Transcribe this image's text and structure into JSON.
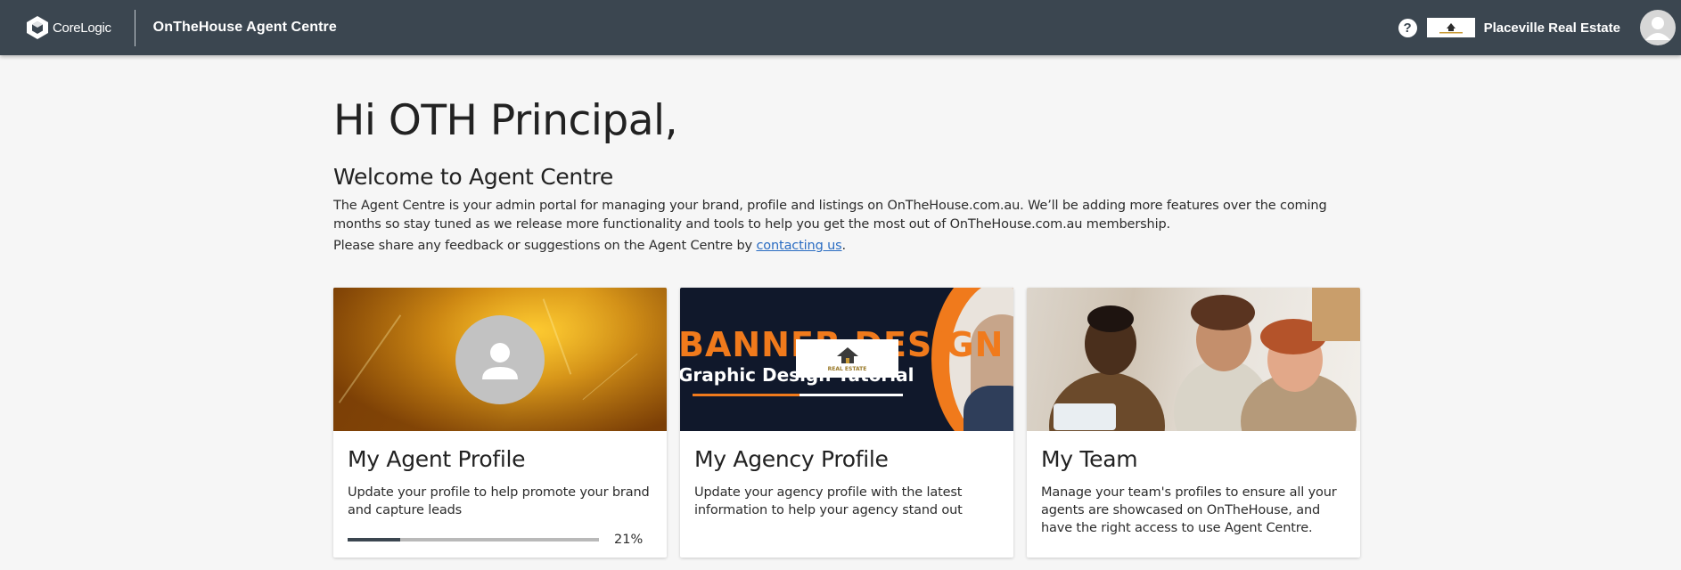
{
  "header": {
    "brand_name": "CoreLogic",
    "app_title": "OnTheHouse Agent Centre",
    "help_symbol": "?",
    "agency_name": "Placeville Real Estate",
    "icons": [
      "corelogic-logo",
      "help-icon",
      "agency-logo",
      "user-avatar-icon"
    ]
  },
  "main": {
    "greeting": "Hi OTH Principal,",
    "welcome_title": "Welcome to Agent Centre",
    "intro": "The Agent Centre is your admin portal for managing your brand, profile and listings on OnTheHouse.com.au. We’ll be adding more features over the coming months so stay tuned as we release more functionality and tools to help you get the most out of OnTheHouse.com.au membership.",
    "feedback_prefix": "Please share any feedback or suggestions on the Agent Centre by ",
    "feedback_link": "contacting us",
    "feedback_suffix": "."
  },
  "cards": [
    {
      "title": "My Agent Profile",
      "description": "Update your profile to help promote your brand and capture leads",
      "progress_percent": 21,
      "progress_label": "21%"
    },
    {
      "title": "My Agency Profile",
      "description": "Update your agency profile with the latest information to help your agency stand out",
      "banner_title": "BANNER DESIGN",
      "banner_subtitle": "Graphic Design Tutorial",
      "logo_text": "REAL ESTATE"
    },
    {
      "title": "My Team",
      "description": "Manage your team's profiles to ensure all your agents are showcased on OnTheHouse, and have the right access to use Agent Centre."
    }
  ],
  "colors": {
    "header_bg": "#3b4650",
    "page_bg": "#f6f6f6",
    "link": "#2a6cc2",
    "progress_fill": "#3b4650",
    "banner_orange": "#f07a1c"
  }
}
